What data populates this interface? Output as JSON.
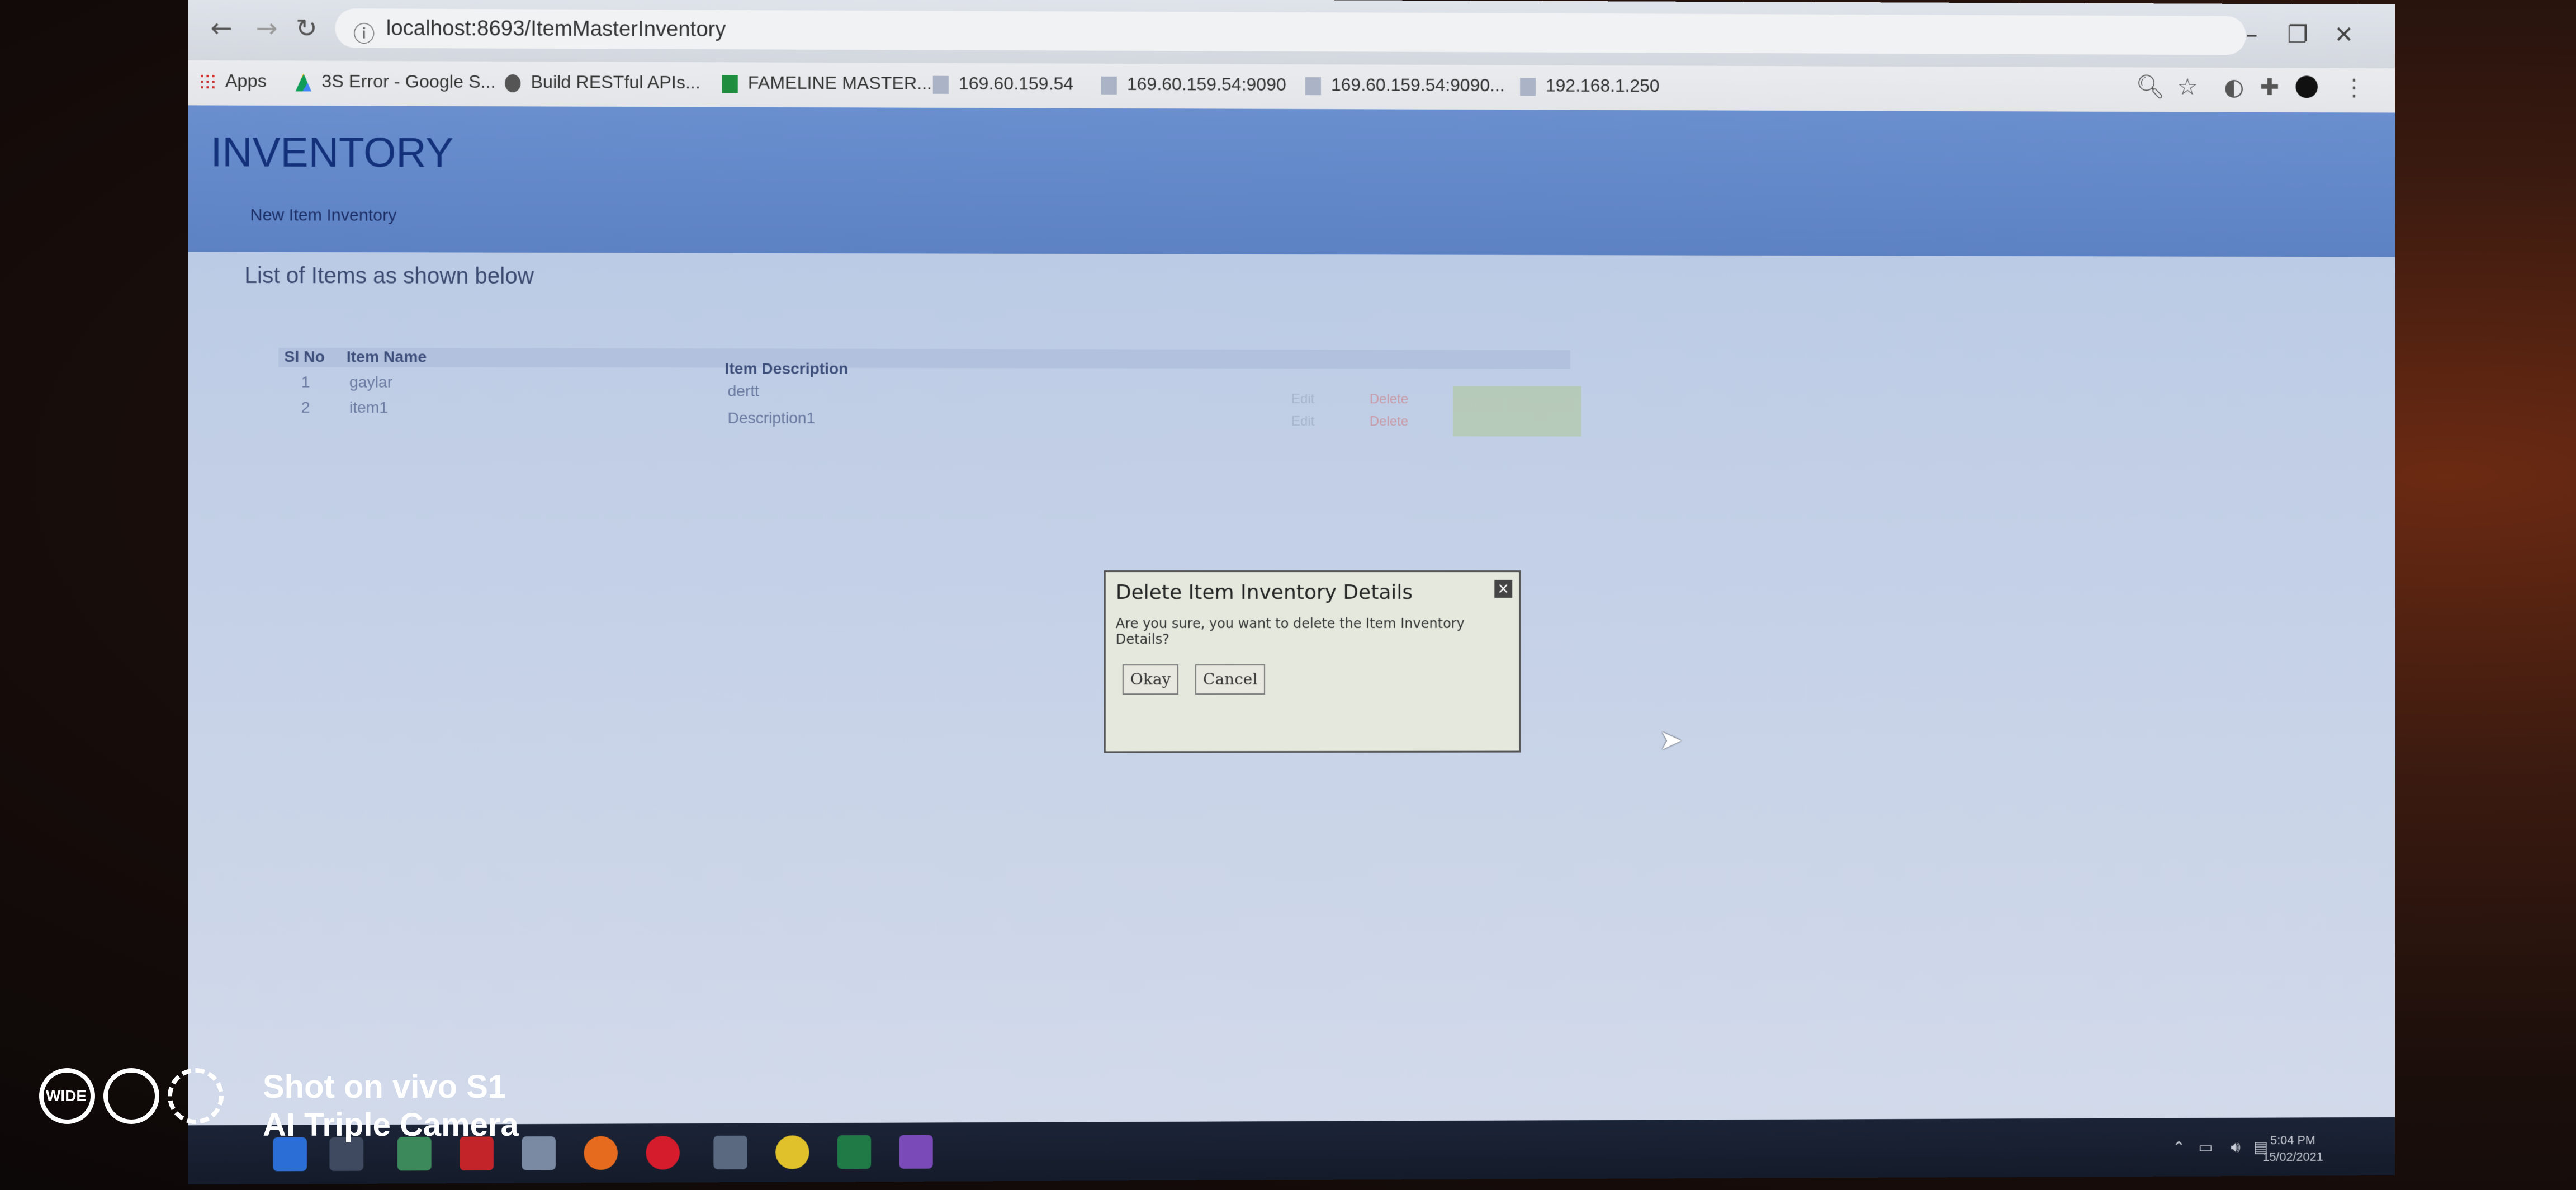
{
  "browser": {
    "url": "localhost:8693/ItemMasterInventory",
    "bookmarks": [
      {
        "label": "Apps",
        "icon": "apps-grid-icon"
      },
      {
        "label": "3S Error - Google S...",
        "icon": "google-drive-icon"
      },
      {
        "label": "Build RESTful APIs...",
        "icon": "globe-icon"
      },
      {
        "label": "FAMELINE MASTER...",
        "icon": "google-sheets-icon"
      },
      {
        "label": "169.60.159.54",
        "icon": "page-icon"
      },
      {
        "label": "169.60.159.54:9090",
        "icon": "page-icon"
      },
      {
        "label": "169.60.159.54:9090...",
        "icon": "page-icon"
      },
      {
        "label": "192.168.1.250",
        "icon": "page-icon"
      }
    ]
  },
  "app": {
    "title": "INVENTORY",
    "nav_link": "New Item Inventory",
    "list_heading": "List of Items as shown below",
    "table": {
      "headers": [
        "Sl No",
        "Item Name",
        "Item Description"
      ],
      "rows": [
        {
          "sl": "1",
          "name": "gaylar",
          "description": "dertt",
          "edit": "Edit",
          "delete": "Delete"
        },
        {
          "sl": "2",
          "name": "item1",
          "description": "Description1",
          "edit": "Edit",
          "delete": "Delete"
        }
      ]
    }
  },
  "dialog": {
    "title": "Delete Item Inventory Details",
    "message": "Are you sure, you want to delete the Item Inventory Details?",
    "ok_label": "Okay",
    "cancel_label": "Cancel"
  },
  "taskbar": {
    "time": "5:04 PM",
    "date": "15/02/2021"
  },
  "watermark": {
    "badge": "WIDE",
    "line1": "Shot on vivo S1",
    "line2": "AI Triple Camera"
  },
  "colors": {
    "header_bg": "#6a8fcf",
    "dialog_bg": "#e4e8dd",
    "taskbar_bg": "#1b2437"
  }
}
